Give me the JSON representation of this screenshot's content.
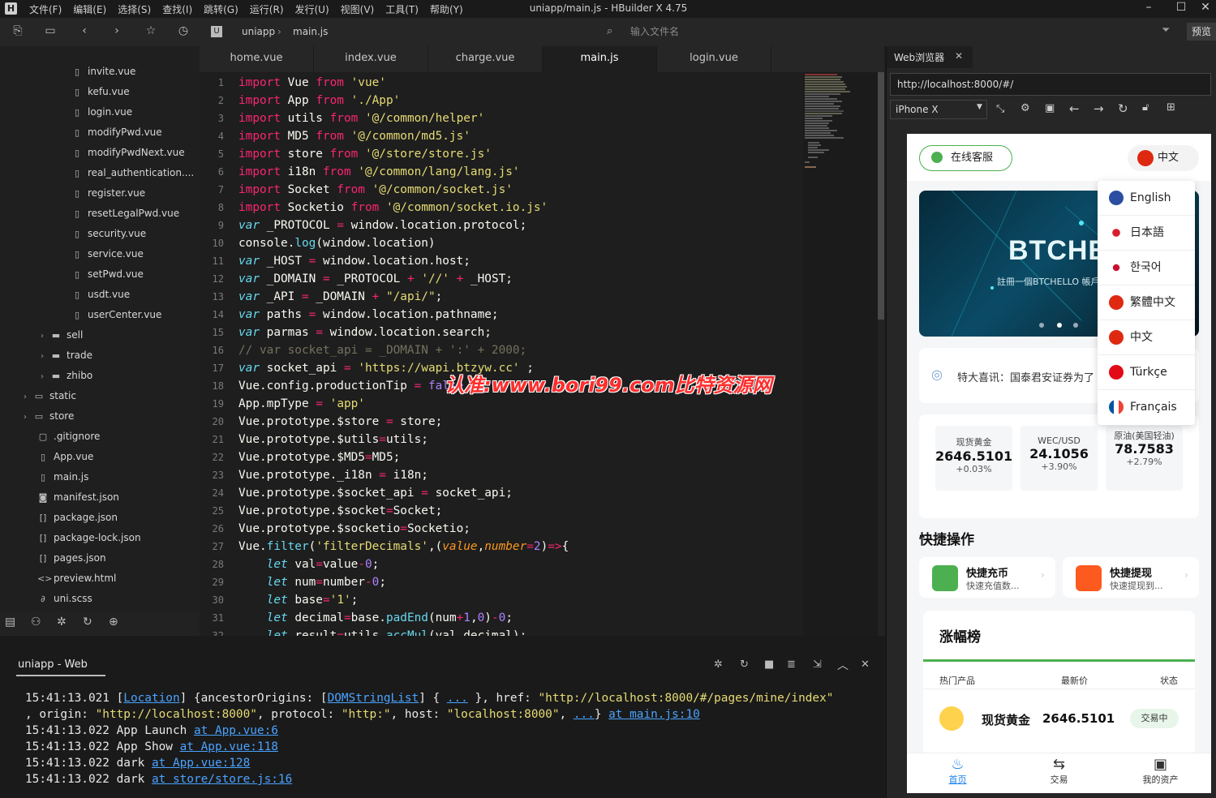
{
  "app": {
    "title": "uniapp/main.js - HBuilder X 4.75",
    "logo": "H"
  },
  "menu": [
    "文件(F)",
    "编辑(E)",
    "选择(S)",
    "查找(I)",
    "跳转(G)",
    "运行(R)",
    "发行(U)",
    "视图(V)",
    "工具(T)",
    "帮助(Y)"
  ],
  "toolbar": {
    "crumb_project": "uniapp",
    "crumb_file": "main.js",
    "file_placeholder": "输入文件名",
    "preview": "预览"
  },
  "sidebar": {
    "items": [
      {
        "label": "invite.vue",
        "icon": "vue-file-icon"
      },
      {
        "label": "kefu.vue",
        "icon": "vue-file-icon"
      },
      {
        "label": "login.vue",
        "icon": "vue-file-icon"
      },
      {
        "label": "modifyPwd.vue",
        "icon": "vue-file-icon"
      },
      {
        "label": "modifyPwdNext.vue",
        "icon": "vue-file-icon"
      },
      {
        "label": "real_authentication....",
        "icon": "vue-file-icon"
      },
      {
        "label": "register.vue",
        "icon": "vue-file-icon"
      },
      {
        "label": "resetLegalPwd.vue",
        "icon": "vue-file-icon"
      },
      {
        "label": "security.vue",
        "icon": "vue-file-icon"
      },
      {
        "label": "service.vue",
        "icon": "vue-file-icon"
      },
      {
        "label": "setPwd.vue",
        "icon": "vue-file-icon"
      },
      {
        "label": "usdt.vue",
        "icon": "vue-file-icon"
      },
      {
        "label": "userCenter.vue",
        "icon": "vue-file-icon"
      },
      {
        "label": "sell",
        "icon": "folder-icon"
      },
      {
        "label": "trade",
        "icon": "folder-icon"
      },
      {
        "label": "zhibo",
        "icon": "folder-icon"
      },
      {
        "label": "static",
        "icon": "folder-icon"
      },
      {
        "label": "store",
        "icon": "folder-icon"
      },
      {
        "label": ".gitignore",
        "icon": "file-icon"
      },
      {
        "label": "App.vue",
        "icon": "vue-file-icon"
      },
      {
        "label": "main.js",
        "icon": "js-file-icon"
      },
      {
        "label": "manifest.json",
        "icon": "manifest-icon"
      },
      {
        "label": "package.json",
        "icon": "json-file-icon"
      },
      {
        "label": "package-lock.json",
        "icon": "json-file-icon"
      },
      {
        "label": "pages.json",
        "icon": "json-file-icon"
      },
      {
        "label": "preview.html",
        "icon": "html-file-icon"
      },
      {
        "label": "uni.scss",
        "icon": "scss-file-icon"
      }
    ]
  },
  "tabs": [
    "home.vue",
    "index.vue",
    "charge.vue",
    "main.js",
    "login.vue"
  ],
  "editor": {
    "lines": [
      "1",
      "2",
      "3",
      "4",
      "5",
      "6",
      "7",
      "8",
      "9",
      "10",
      "11",
      "12",
      "13",
      "14",
      "15",
      "16",
      "17",
      "18",
      "19",
      "20",
      "21",
      "22",
      "23",
      "24",
      "25",
      "26",
      "27",
      "28",
      "29",
      "30",
      "31",
      "32"
    ]
  },
  "watermark": "认准:www.bori99.com比特资源网",
  "console": {
    "tab": "uniapp - Web",
    "l1_time": "15:41:13.021",
    "l1_loc": "Location",
    "l1_mid": "] {ancestorOrigins: [",
    "l1_dsl": "DOMStringList",
    "l1_dots": "...",
    "l1_href_key": "}, href: ",
    "l1_href": "\"http://localhost:8000/#/pages/mine/index\"",
    "l2_a": ", origin: ",
    "l2_origin": "\"http://localhost:8000\"",
    "l2_b": ", protocol: ",
    "l2_proto": "\"http:\"",
    "l2_c": ", host: ",
    "l2_host": "\"localhost:8000\"",
    "l2_d": ", ",
    "l2_dots": "...",
    "l2_e": "} ",
    "l2_at": "at main.js:10",
    "l3_time": "15:41:13.022",
    "l3_text": "App Launch ",
    "l3_at": "at App.vue:6",
    "l4_time": "15:41:13.022",
    "l4_text": "App Show ",
    "l4_at": "at App.vue:118",
    "l5_time": "15:41:13.022",
    "l5_text": "dark ",
    "l5_at": "at App.vue:128",
    "l6_time": "15:41:13.022",
    "l6_text": "dark ",
    "l6_at": "at store/store.js:16"
  },
  "browser": {
    "tab": "Web浏览器",
    "url": "http://localhost:8000/#/",
    "device": "iPhone X"
  },
  "phone": {
    "service_btn": "在线客服",
    "lang_btn": "中文",
    "banner_title": "BTCHELL",
    "banner_sub": "註冊一個BTCHELLO 帳戶並",
    "languages": [
      {
        "label": "English",
        "color": "#2b4ea2"
      },
      {
        "label": "日本語",
        "color": "#d81e2c"
      },
      {
        "label": "한국어",
        "color": "#c8102e"
      },
      {
        "label": "繁體中文",
        "color": "#de2910"
      },
      {
        "label": "中文",
        "color": "#de2910"
      },
      {
        "label": "Türkçe",
        "color": "#e30a17"
      },
      {
        "label": "Français",
        "color": "#0055a4"
      }
    ],
    "notice": "特大喜讯：国泰君安证券为了",
    "markets": [
      {
        "name": "现货黄金",
        "price": "2646.5101",
        "change": "+0.03%"
      },
      {
        "name": "WEC/USD",
        "price": "24.1056",
        "change": "+3.90%"
      },
      {
        "name": "原油(美国轻油)",
        "price": "78.7583",
        "change": "+2.79%"
      }
    ],
    "quick_title": "快捷操作",
    "quick": [
      {
        "title": "快捷充币",
        "sub": "快速充值数...",
        "color": "#4cb050"
      },
      {
        "title": "快捷提现",
        "sub": "快速提现到...",
        "color": "#fd5a1f"
      }
    ],
    "rank_title": "涨幅榜",
    "rank_headers": [
      "热门产品",
      "最新价",
      "状态"
    ],
    "rank_row": {
      "name": "现货黄金",
      "price": "2646.5101",
      "status": "交易中"
    },
    "nav": [
      "首页",
      "交易",
      "我的资产"
    ]
  }
}
